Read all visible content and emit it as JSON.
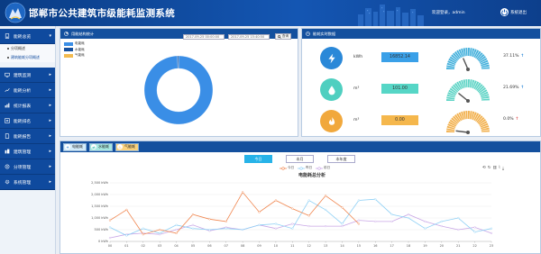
{
  "header": {
    "title": "邯郸市公共建筑市级能耗监测系统",
    "welcome": "欢迎登录，admin",
    "exit_label": "系统退出"
  },
  "sidebar": {
    "items": [
      {
        "label": "能耗总览",
        "icon": "building-icon",
        "expanded": true
      },
      {
        "label": "建筑监测",
        "icon": "monitor-icon"
      },
      {
        "label": "能耗分析",
        "icon": "analysis-icon"
      },
      {
        "label": "统计报表",
        "icon": "report-icon"
      },
      {
        "label": "能耗排名",
        "icon": "rank-icon"
      },
      {
        "label": "能耗报告",
        "icon": "doc-icon"
      },
      {
        "label": "建筑管理",
        "icon": "building-mgmt-icon"
      },
      {
        "label": "分项管理",
        "icon": "subitem-icon"
      },
      {
        "label": "系统管理",
        "icon": "settings-icon"
      }
    ],
    "subitems": [
      {
        "label": "分项概述"
      },
      {
        "label": "建筑能耗分项概述"
      }
    ]
  },
  "pie_panel": {
    "title": "用能结构统计",
    "date_from": "2017-09-25 00:00:00",
    "date_to": "2017-09-25 15:40:50",
    "search_label": "查询",
    "legend": [
      {
        "name": "电能耗",
        "color": "#3a8ee6"
      },
      {
        "name": "水能耗",
        "color": "#15509e"
      },
      {
        "name": "气能耗",
        "color": "#f3bb50"
      }
    ],
    "chart_data": {
      "type": "pie",
      "labels": [
        "电能耗",
        "水能耗",
        "气能耗"
      ],
      "values": [
        99.5,
        0.5,
        0.0
      ],
      "colors": [
        "#3a8ee6",
        "#15509e",
        "#f3bb50"
      ]
    }
  },
  "realtime_panel": {
    "title": "能耗实时数据",
    "rows": [
      {
        "icon": "lightning-icon",
        "unit": "kWh",
        "value": "16852.14",
        "pct": "37.11%",
        "arrow": "↑",
        "arrow_color": "#2a88d8",
        "icon_bg": "#2a88d8",
        "value_bg": "#3aa0e8",
        "gauge_color": "#32a8d8",
        "gauge_level": 0.3711
      },
      {
        "icon": "water-drop-icon",
        "unit": "m³",
        "value": "101.00",
        "pct": "21.69%",
        "arrow": "↑",
        "arrow_color": "#2a88d8",
        "icon_bg": "#4fcfc0",
        "value_bg": "#56d6c6",
        "gauge_color": "#4fcfc0",
        "gauge_level": 0.2169
      },
      {
        "icon": "flame-icon",
        "unit": "m³",
        "value": "0.00",
        "pct": "0.0%",
        "arrow": "↑",
        "arrow_color": "#e05555",
        "icon_bg": "#f1a83c",
        "value_bg": "#f5b74c",
        "gauge_color": "#f1a83c",
        "gauge_level": 0.0
      }
    ]
  },
  "bottom_panel": {
    "tabs": [
      {
        "label": "电能耗",
        "icon_text": "+",
        "bg": "#d3ecfa"
      },
      {
        "label": "水能耗",
        "icon_text": "⇄",
        "bg": "#a7e8e0"
      },
      {
        "label": "气能耗",
        "icon_text": "♨",
        "bg": "#fbd27c"
      }
    ],
    "periods": [
      {
        "label": "今日",
        "active": true
      },
      {
        "label": "本月",
        "active": false
      },
      {
        "label": "本年度",
        "active": false
      }
    ],
    "tools": [
      "restore-icon",
      "refresh-icon",
      "bar-icon",
      "line-icon",
      "save-icon"
    ],
    "chart_data": {
      "type": "line",
      "title": "电能耗总分析",
      "x": [
        "00",
        "01",
        "02",
        "03",
        "04",
        "05",
        "06",
        "07",
        "08",
        "09",
        "10",
        "11",
        "12",
        "13",
        "14",
        "15",
        "16",
        "17",
        "18",
        "19",
        "20",
        "21",
        "22",
        "23"
      ],
      "ylim": [
        0,
        2500
      ],
      "yticks": [
        "0 kWh",
        "500 kWh",
        "1,000 kWh",
        "1,500 kWh",
        "2,000 kWh",
        "2,500 kWh"
      ],
      "series": [
        {
          "name": "今日",
          "color": "#f0864f",
          "values": [
            900,
            1350,
            300,
            500,
            350,
            1150,
            950,
            850,
            2100,
            1250,
            1750,
            1400,
            1100,
            1950,
            1450,
            750,
            null,
            null,
            null,
            null,
            null,
            null,
            null,
            null
          ]
        },
        {
          "name": "昨日",
          "color": "#8ed0f5",
          "values": [
            600,
            250,
            550,
            350,
            700,
            550,
            500,
            550,
            500,
            700,
            750,
            550,
            1750,
            1350,
            750,
            1750,
            1800,
            1150,
            1000,
            550,
            850,
            1000,
            400,
            550
          ]
        },
        {
          "name": "前日",
          "color": "#c8a6e6",
          "values": [
            150,
            300,
            350,
            300,
            500,
            700,
            450,
            600,
            500,
            700,
            550,
            750,
            650,
            650,
            650,
            900,
            850,
            850,
            1150,
            850,
            650,
            500,
            600,
            350
          ]
        }
      ]
    }
  }
}
